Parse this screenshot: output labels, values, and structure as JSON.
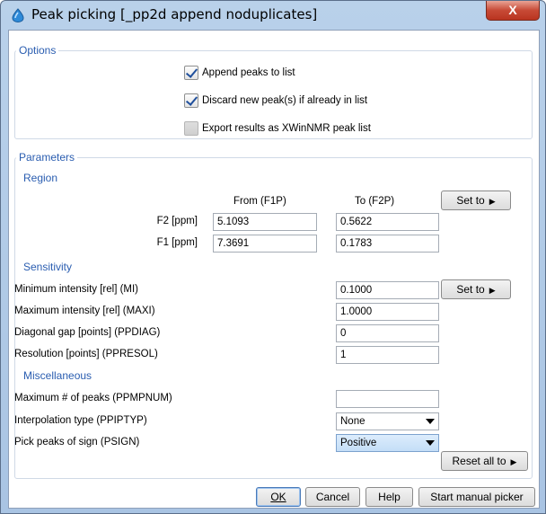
{
  "window": {
    "title": "Peak picking [_pp2d append noduplicates]",
    "close_label": "X"
  },
  "options": {
    "title": "Options",
    "checkboxes": [
      {
        "label": "Append peaks to list",
        "checked": true
      },
      {
        "label": "Discard new peak(s) if already in list",
        "checked": true
      },
      {
        "label": "Export results as XWinNMR peak list",
        "checked": false
      }
    ]
  },
  "parameters": {
    "title": "Parameters",
    "region": {
      "label": "Region",
      "col_from": "From (F1P)",
      "col_to": "To (F2P)",
      "set_to_label": "Set to",
      "rows": [
        {
          "label": "F2 [ppm]",
          "from": "5.1093",
          "to": "0.5622"
        },
        {
          "label": "F1 [ppm]",
          "from": "7.3691",
          "to": "0.1783"
        }
      ]
    },
    "sensitivity": {
      "label": "Sensitivity",
      "set_to_label": "Set to",
      "rows": [
        {
          "label": "Minimum intensity [rel] (MI)",
          "value": "0.1000"
        },
        {
          "label": "Maximum intensity [rel] (MAXI)",
          "value": "1.0000"
        },
        {
          "label": "Diagonal gap [points] (PPDIAG)",
          "value": "0"
        },
        {
          "label": "Resolution [points] (PPRESOL)",
          "value": "1"
        }
      ]
    },
    "misc": {
      "label": "Miscellaneous",
      "max_peaks_label": "Maximum # of peaks (PPMPNUM)",
      "max_peaks_value": "",
      "interp_label": "Interpolation type (PPIPTYP)",
      "interp_value": "None",
      "sign_label": "Pick peaks of sign (PSIGN)",
      "sign_value": "Positive"
    },
    "reset_label": "Reset all to"
  },
  "buttons": {
    "ok": "OK",
    "cancel": "Cancel",
    "help": "Help",
    "manual": "Start manual picker"
  }
}
